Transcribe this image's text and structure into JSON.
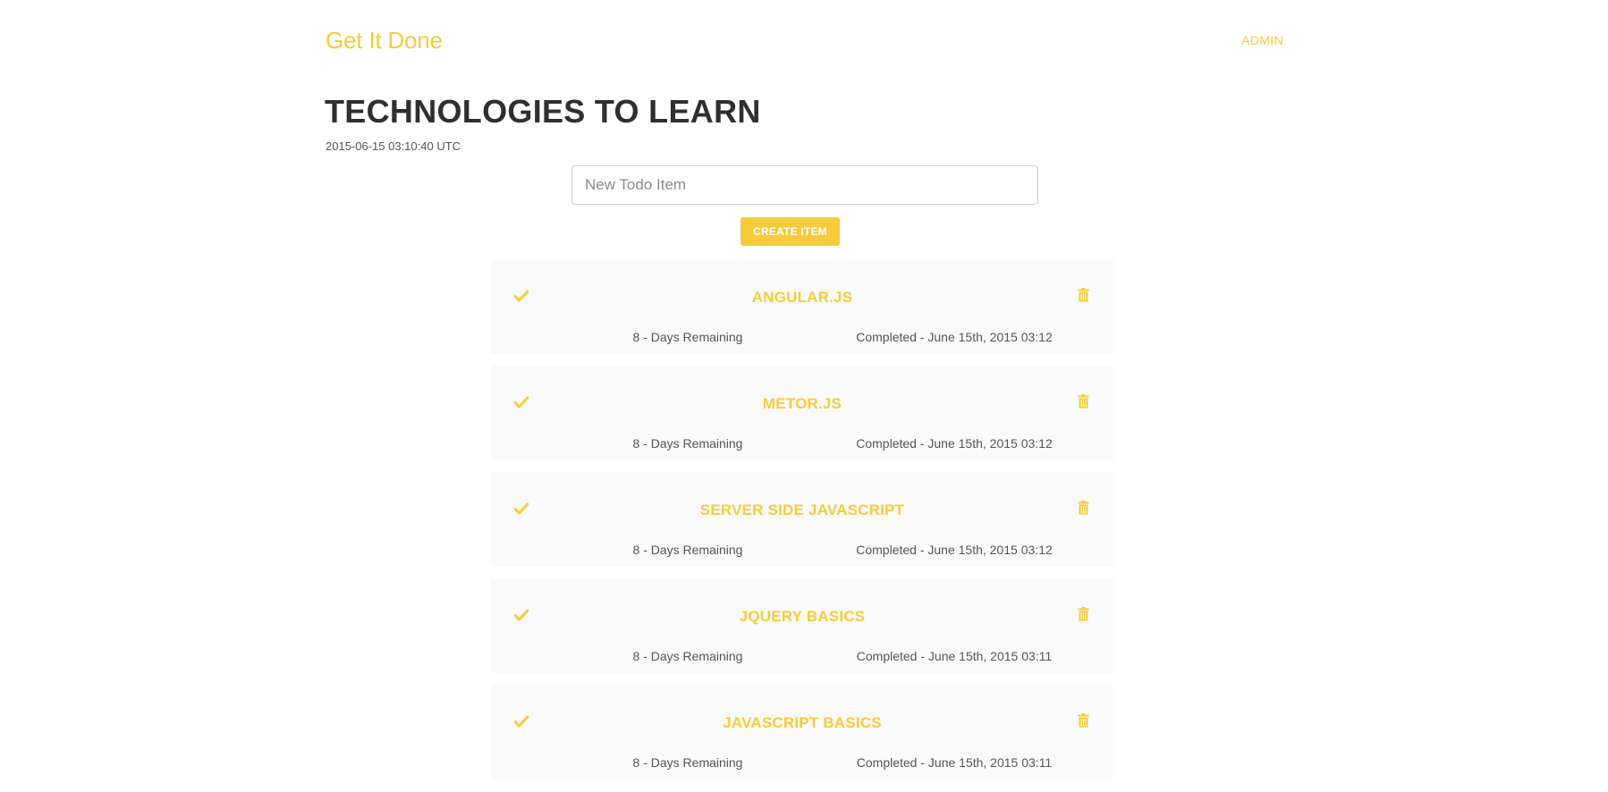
{
  "header": {
    "brand": "Get It Done",
    "admin_link": "ADMIN"
  },
  "list": {
    "title": "TECHNOLOGIES TO LEARN",
    "timestamp": "2015-06-15 03:10:40 UTC"
  },
  "new_item": {
    "placeholder": "New Todo Item",
    "value": "",
    "create_label": "CREATE ITEM"
  },
  "colors": {
    "accent": "#f7cb3a",
    "title": "#2f2f2f",
    "card_background": "#fafafa"
  },
  "icons": {
    "complete": "check-icon",
    "delete": "trash-icon"
  },
  "items": [
    {
      "name": "ANGULAR.JS",
      "remaining": "8 - Days Remaining",
      "completed": "Completed - June 15th, 2015 03:12"
    },
    {
      "name": "METOR.JS",
      "remaining": "8 - Days Remaining",
      "completed": "Completed - June 15th, 2015 03:12"
    },
    {
      "name": "SERVER SIDE JAVASCRIPT",
      "remaining": "8 - Days Remaining",
      "completed": "Completed - June 15th, 2015 03:12"
    },
    {
      "name": "JQUERY BASICS",
      "remaining": "8 - Days Remaining",
      "completed": "Completed - June 15th, 2015 03:11"
    },
    {
      "name": "JAVASCRIPT BASICS",
      "remaining": "8 - Days Remaining",
      "completed": "Completed - June 15th, 2015 03:11"
    }
  ]
}
